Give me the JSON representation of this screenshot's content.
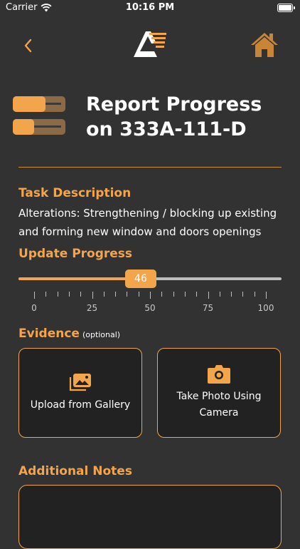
{
  "status_bar": {
    "carrier": "Carrier",
    "time": "10:16 PM"
  },
  "header": {
    "title": "Report Progress on 333A-111-D"
  },
  "task": {
    "label": "Task Description",
    "description": "Alterations: Strengthening / blocking up existing and forming new window and doors openings"
  },
  "progress": {
    "label": "Update Progress",
    "value": 46,
    "min": 0,
    "max": 100,
    "tick_labels": [
      "0",
      "25",
      "50",
      "75",
      "100"
    ]
  },
  "evidence": {
    "label": "Evidence",
    "optional_label": "(optional)",
    "upload_label": "Upload from Gallery",
    "camera_label": "Take Photo Using\nCamera"
  },
  "notes": {
    "label": "Additional Notes",
    "value": ""
  },
  "icons": {
    "back": "chevron-left-icon",
    "logo": "app-logo",
    "home": "home-icon",
    "header": "progress-bars-icon",
    "gallery": "gallery-icon",
    "camera": "camera-icon"
  },
  "colors": {
    "background": "#323232",
    "accent": "#f3a54c",
    "accent_dark": "#8c6a45",
    "card_background": "#222222",
    "track": "#bdbdbd"
  }
}
